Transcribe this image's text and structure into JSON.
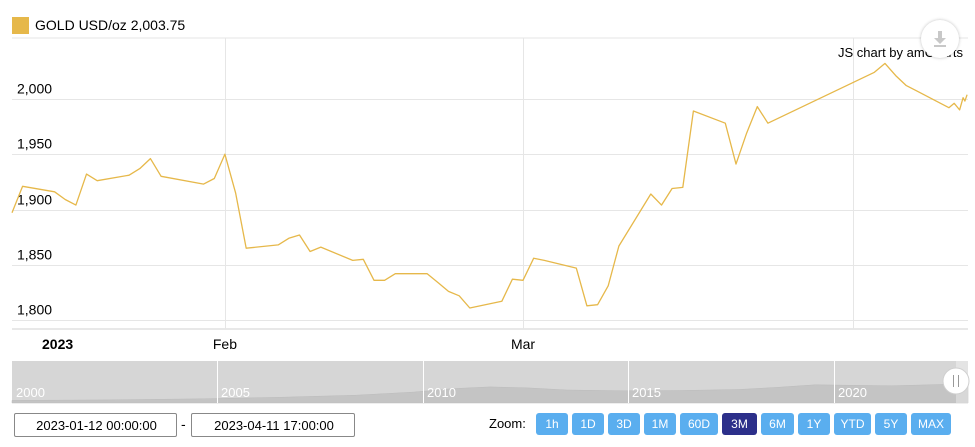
{
  "legend": {
    "label": "GOLD USD/oz 2,003.75",
    "color": "#e6b84a"
  },
  "credit": "JS chart by amCharts",
  "export_icon": "download-arrow-icon",
  "date_range": {
    "from": "2023-01-12 00:00:00",
    "separator": "-",
    "to": "2023-04-11 17:00:00"
  },
  "zoom": {
    "label": "Zoom:",
    "buttons": [
      "1h",
      "1D",
      "3D",
      "1M",
      "60D",
      "3M",
      "6M",
      "1Y",
      "YTD",
      "5Y",
      "MAX"
    ],
    "active": "3M",
    "button_color": "#5aaeef",
    "active_color": "#2c2f8a"
  },
  "navigator": {
    "year_labels": [
      "2000",
      "2005",
      "2010",
      "2015",
      "2020"
    ]
  },
  "chart_data": {
    "type": "line",
    "series": [
      {
        "color": "#e6b84a",
        "points": [
          [
            "2023-01-12",
            1897
          ],
          [
            "2023-01-13",
            1921
          ],
          [
            "2023-01-16",
            1916
          ],
          [
            "2023-01-17",
            1909
          ],
          [
            "2023-01-18",
            1904
          ],
          [
            "2023-01-19",
            1932
          ],
          [
            "2023-01-20",
            1926
          ],
          [
            "2023-01-23",
            1931
          ],
          [
            "2023-01-24",
            1937
          ],
          [
            "2023-01-25",
            1946
          ],
          [
            "2023-01-26",
            1930
          ],
          [
            "2023-01-30",
            1923
          ],
          [
            "2023-01-31",
            1928
          ],
          [
            "2023-02-01",
            1950
          ],
          [
            "2023-02-02",
            1915
          ],
          [
            "2023-02-03",
            1865
          ],
          [
            "2023-02-06",
            1868
          ],
          [
            "2023-02-07",
            1874
          ],
          [
            "2023-02-08",
            1877
          ],
          [
            "2023-02-09",
            1862
          ],
          [
            "2023-02-10",
            1866
          ],
          [
            "2023-02-13",
            1854
          ],
          [
            "2023-02-14",
            1855
          ],
          [
            "2023-02-15",
            1836
          ],
          [
            "2023-02-16",
            1836
          ],
          [
            "2023-02-17",
            1842
          ],
          [
            "2023-02-20",
            1842
          ],
          [
            "2023-02-21",
            1834
          ],
          [
            "2023-02-22",
            1826
          ],
          [
            "2023-02-23",
            1822
          ],
          [
            "2023-02-24",
            1811
          ],
          [
            "2023-02-27",
            1817
          ],
          [
            "2023-02-28",
            1837
          ],
          [
            "2023-03-01",
            1836
          ],
          [
            "2023-03-02",
            1856
          ],
          [
            "2023-03-03",
            1854
          ],
          [
            "2023-03-06",
            1847
          ],
          [
            "2023-03-07",
            1813
          ],
          [
            "2023-03-08",
            1814
          ],
          [
            "2023-03-09",
            1831
          ],
          [
            "2023-03-10",
            1867
          ],
          [
            "2023-03-13",
            1914
          ],
          [
            "2023-03-14",
            1904
          ],
          [
            "2023-03-15",
            1919
          ],
          [
            "2023-03-16",
            1920
          ],
          [
            "2023-03-17",
            1989
          ],
          [
            "2023-03-20",
            1978
          ],
          [
            "2023-03-21",
            1941
          ],
          [
            "2023-03-22",
            1969
          ],
          [
            "2023-03-23",
            1993
          ],
          [
            "2023-03-24",
            1978
          ],
          [
            "2023-04-03",
            2024
          ],
          [
            "2023-04-04",
            2032
          ],
          [
            "2023-04-05",
            2021
          ],
          [
            "2023-04-06",
            2012
          ],
          [
            "2023-04-07",
            2007
          ],
          [
            "2023-04-10",
            1992
          ],
          [
            "2023-04-10T12:00",
            1996
          ],
          [
            "2023-04-11",
            1990
          ],
          [
            "2023-04-11T08:00",
            2001
          ],
          [
            "2023-04-11T12:00",
            1998
          ],
          [
            "2023-04-11T17:00",
            2003.75
          ]
        ]
      }
    ],
    "y_ticks": [
      "1,800",
      "1,850",
      "1,900",
      "1,950",
      "2,000"
    ],
    "ylim": [
      1792,
      2055
    ],
    "x_labels": [
      {
        "date": "2023-01-01",
        "text": "2023",
        "bold": true
      },
      {
        "date": "2023-02-01",
        "text": "Feb",
        "bold": false
      },
      {
        "date": "2023-03-01",
        "text": "Mar",
        "bold": false
      }
    ],
    "x_gridlines": [
      "2023-02-01",
      "2023-03-01",
      "2023-04-01"
    ],
    "grid": true
  }
}
